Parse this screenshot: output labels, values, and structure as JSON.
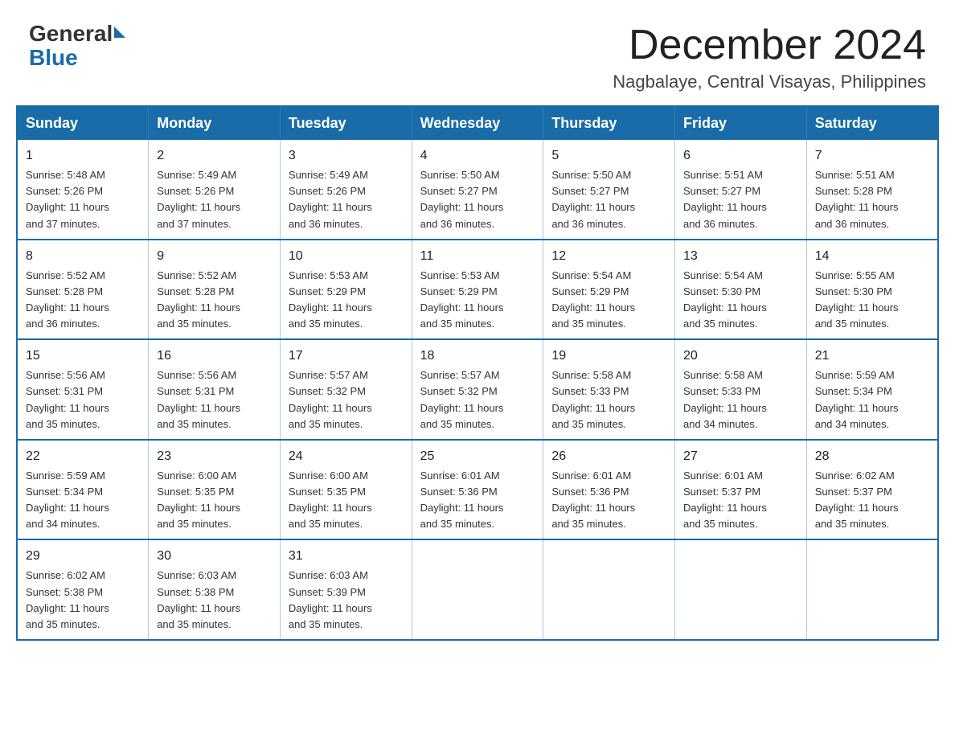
{
  "logo": {
    "general": "General",
    "blue": "Blue"
  },
  "header": {
    "month": "December 2024",
    "location": "Nagbalaye, Central Visayas, Philippines"
  },
  "days_of_week": [
    "Sunday",
    "Monday",
    "Tuesday",
    "Wednesday",
    "Thursday",
    "Friday",
    "Saturday"
  ],
  "weeks": [
    [
      {
        "day": "1",
        "info": "Sunrise: 5:48 AM\nSunset: 5:26 PM\nDaylight: 11 hours\nand 37 minutes."
      },
      {
        "day": "2",
        "info": "Sunrise: 5:49 AM\nSunset: 5:26 PM\nDaylight: 11 hours\nand 37 minutes."
      },
      {
        "day": "3",
        "info": "Sunrise: 5:49 AM\nSunset: 5:26 PM\nDaylight: 11 hours\nand 36 minutes."
      },
      {
        "day": "4",
        "info": "Sunrise: 5:50 AM\nSunset: 5:27 PM\nDaylight: 11 hours\nand 36 minutes."
      },
      {
        "day": "5",
        "info": "Sunrise: 5:50 AM\nSunset: 5:27 PM\nDaylight: 11 hours\nand 36 minutes."
      },
      {
        "day": "6",
        "info": "Sunrise: 5:51 AM\nSunset: 5:27 PM\nDaylight: 11 hours\nand 36 minutes."
      },
      {
        "day": "7",
        "info": "Sunrise: 5:51 AM\nSunset: 5:28 PM\nDaylight: 11 hours\nand 36 minutes."
      }
    ],
    [
      {
        "day": "8",
        "info": "Sunrise: 5:52 AM\nSunset: 5:28 PM\nDaylight: 11 hours\nand 36 minutes."
      },
      {
        "day": "9",
        "info": "Sunrise: 5:52 AM\nSunset: 5:28 PM\nDaylight: 11 hours\nand 35 minutes."
      },
      {
        "day": "10",
        "info": "Sunrise: 5:53 AM\nSunset: 5:29 PM\nDaylight: 11 hours\nand 35 minutes."
      },
      {
        "day": "11",
        "info": "Sunrise: 5:53 AM\nSunset: 5:29 PM\nDaylight: 11 hours\nand 35 minutes."
      },
      {
        "day": "12",
        "info": "Sunrise: 5:54 AM\nSunset: 5:29 PM\nDaylight: 11 hours\nand 35 minutes."
      },
      {
        "day": "13",
        "info": "Sunrise: 5:54 AM\nSunset: 5:30 PM\nDaylight: 11 hours\nand 35 minutes."
      },
      {
        "day": "14",
        "info": "Sunrise: 5:55 AM\nSunset: 5:30 PM\nDaylight: 11 hours\nand 35 minutes."
      }
    ],
    [
      {
        "day": "15",
        "info": "Sunrise: 5:56 AM\nSunset: 5:31 PM\nDaylight: 11 hours\nand 35 minutes."
      },
      {
        "day": "16",
        "info": "Sunrise: 5:56 AM\nSunset: 5:31 PM\nDaylight: 11 hours\nand 35 minutes."
      },
      {
        "day": "17",
        "info": "Sunrise: 5:57 AM\nSunset: 5:32 PM\nDaylight: 11 hours\nand 35 minutes."
      },
      {
        "day": "18",
        "info": "Sunrise: 5:57 AM\nSunset: 5:32 PM\nDaylight: 11 hours\nand 35 minutes."
      },
      {
        "day": "19",
        "info": "Sunrise: 5:58 AM\nSunset: 5:33 PM\nDaylight: 11 hours\nand 35 minutes."
      },
      {
        "day": "20",
        "info": "Sunrise: 5:58 AM\nSunset: 5:33 PM\nDaylight: 11 hours\nand 34 minutes."
      },
      {
        "day": "21",
        "info": "Sunrise: 5:59 AM\nSunset: 5:34 PM\nDaylight: 11 hours\nand 34 minutes."
      }
    ],
    [
      {
        "day": "22",
        "info": "Sunrise: 5:59 AM\nSunset: 5:34 PM\nDaylight: 11 hours\nand 34 minutes."
      },
      {
        "day": "23",
        "info": "Sunrise: 6:00 AM\nSunset: 5:35 PM\nDaylight: 11 hours\nand 35 minutes."
      },
      {
        "day": "24",
        "info": "Sunrise: 6:00 AM\nSunset: 5:35 PM\nDaylight: 11 hours\nand 35 minutes."
      },
      {
        "day": "25",
        "info": "Sunrise: 6:01 AM\nSunset: 5:36 PM\nDaylight: 11 hours\nand 35 minutes."
      },
      {
        "day": "26",
        "info": "Sunrise: 6:01 AM\nSunset: 5:36 PM\nDaylight: 11 hours\nand 35 minutes."
      },
      {
        "day": "27",
        "info": "Sunrise: 6:01 AM\nSunset: 5:37 PM\nDaylight: 11 hours\nand 35 minutes."
      },
      {
        "day": "28",
        "info": "Sunrise: 6:02 AM\nSunset: 5:37 PM\nDaylight: 11 hours\nand 35 minutes."
      }
    ],
    [
      {
        "day": "29",
        "info": "Sunrise: 6:02 AM\nSunset: 5:38 PM\nDaylight: 11 hours\nand 35 minutes."
      },
      {
        "day": "30",
        "info": "Sunrise: 6:03 AM\nSunset: 5:38 PM\nDaylight: 11 hours\nand 35 minutes."
      },
      {
        "day": "31",
        "info": "Sunrise: 6:03 AM\nSunset: 5:39 PM\nDaylight: 11 hours\nand 35 minutes."
      },
      {
        "day": "",
        "info": ""
      },
      {
        "day": "",
        "info": ""
      },
      {
        "day": "",
        "info": ""
      },
      {
        "day": "",
        "info": ""
      }
    ]
  ]
}
